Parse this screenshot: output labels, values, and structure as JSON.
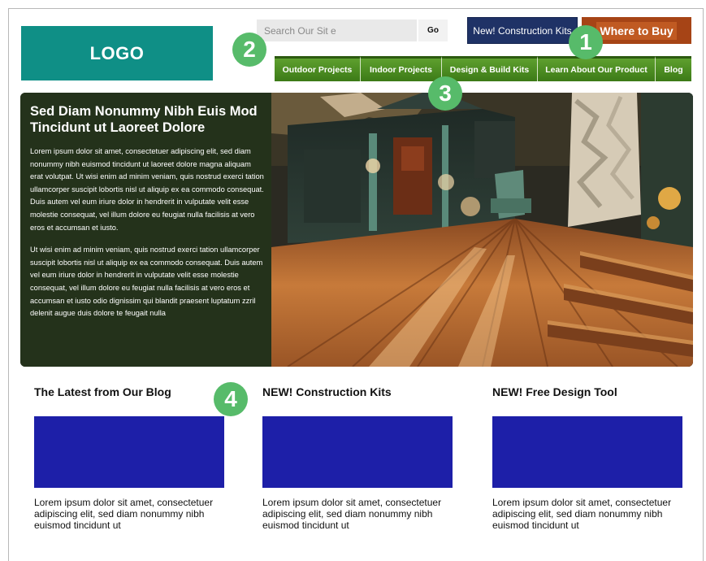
{
  "header": {
    "logo": "LOGO",
    "search": {
      "placeholder": "Search Our Sit e",
      "go_label": "Go"
    },
    "kits_button": "New! Construction Kits",
    "buy_button": "Where to Buy"
  },
  "nav": {
    "items": [
      {
        "label": "Outdoor Projects"
      },
      {
        "label": "Indoor Projects"
      },
      {
        "label": "Design & Build Kits"
      },
      {
        "label": "Learn About Our Product"
      },
      {
        "label": "Blog"
      }
    ]
  },
  "hero": {
    "title": "Sed Diam Nonummy Nibh Euis Mod Tincidunt ut Laoreet Dolore",
    "paragraphs": [
      "Lorem ipsum dolor sit amet, consectetuer adipiscing elit, sed diam nonummy nibh euismod tincidunt ut laoreet dolore magna aliquam erat volutpat. Ut wisi enim ad minim veniam, quis nostrud exerci tation ullamcorper suscipit lobortis nisl ut aliquip ex ea commodo consequat. Duis autem vel eum iriure dolor in hendrerit in vulputate velit esse molestie consequat, vel illum dolore eu feugiat nulla facilisis at vero eros et accumsan et iusto.",
      "Ut wisi enim ad minim veniam, quis nostrud exerci tation ullamcorper suscipit lobortis nisl ut aliquip ex ea commodo consequat. Duis autem vel eum iriure dolor in hendrerit in vulputate velit esse molestie consequat, vel illum dolore eu feugiat nulla facilisis at vero eros et accumsan et iusto odio dignissim qui blandit praesent luptatum zzril delenit augue duis dolore te feugait nulla"
    ]
  },
  "callouts": [
    "1",
    "2",
    "3",
    "4"
  ],
  "columns": [
    {
      "title": "The Latest from Our Blog",
      "text": "Lorem ipsum dolor sit amet, consectetuer adipiscing elit, sed diam nonummy nibh euismod tincidunt ut"
    },
    {
      "title": "NEW! Construction Kits",
      "text": "Lorem ipsum dolor sit amet, consectetuer adipiscing elit, sed diam nonummy nibh euismod tincidunt ut"
    },
    {
      "title": "NEW! Free Design Tool",
      "text": "Lorem ipsum dolor sit amet, consectetuer adipiscing elit, sed diam nonummy nibh euismod tincidunt ut"
    }
  ],
  "colors": {
    "logo": "#0f8f86",
    "nav_green": "#4a8a22",
    "kits_navy": "#1f3266",
    "buy_orange": "#a64416",
    "hero_panel": "#24321b",
    "placeholder_blue": "#1d1fa8",
    "callout_green": "#57bb6a"
  }
}
